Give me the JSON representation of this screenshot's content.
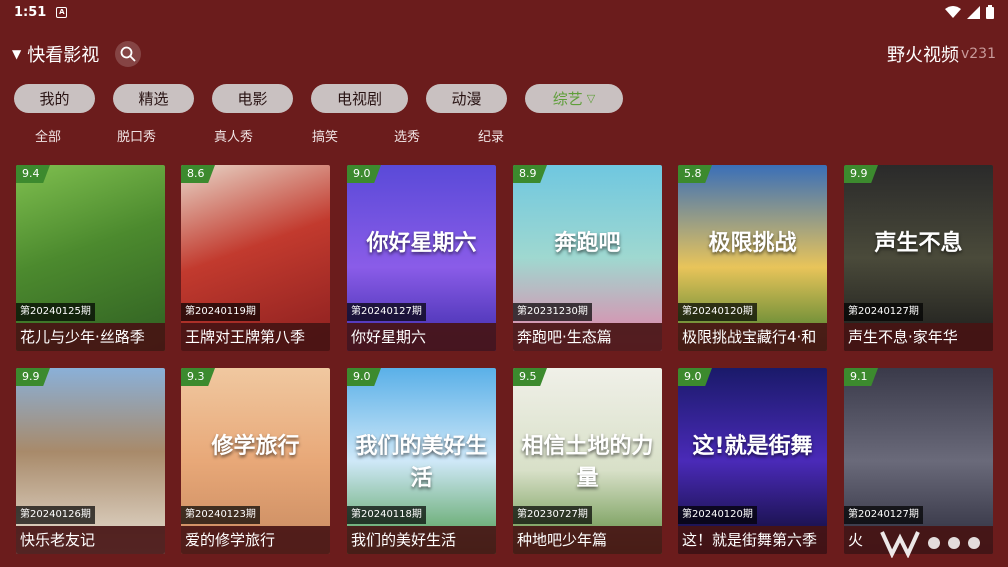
{
  "status": {
    "time": "1:51",
    "notif_glyph": "A"
  },
  "header": {
    "caret": "▼",
    "title": "快看影视",
    "brand": "野火视频",
    "version": "v231"
  },
  "tabs": [
    {
      "label": "我的"
    },
    {
      "label": "精选"
    },
    {
      "label": "电影"
    },
    {
      "label": "电视剧"
    },
    {
      "label": "动漫"
    },
    {
      "label": "综艺"
    }
  ],
  "subtabs": [
    "全部",
    "脱口秀",
    "真人秀",
    "搞笑",
    "选秀",
    "纪录"
  ],
  "cards": [
    {
      "rating": "9.4",
      "episode": "第20240125期",
      "title": "花儿与少年·丝路季",
      "poster": "green-field"
    },
    {
      "rating": "8.6",
      "episode": "第20240119期",
      "title": "王牌对王牌第八季",
      "poster": "red-party"
    },
    {
      "rating": "9.0",
      "episode": "第20240127期",
      "title": "你好星期六",
      "poster": "purple-show",
      "overlay": "你好星期六"
    },
    {
      "rating": "8.9",
      "episode": "第20231230期",
      "title": "奔跑吧·生态篇",
      "poster": "teal-run",
      "overlay": "奔跑吧"
    },
    {
      "rating": "5.8",
      "episode": "第20240120期",
      "title": "极限挑战宝藏行4·和",
      "poster": "sunset-hill",
      "overlay": "极限挑战"
    },
    {
      "rating": "9.9",
      "episode": "第20240127期",
      "title": "声生不息·家年华",
      "poster": "dark-vinyl",
      "overlay": "声生不息"
    },
    {
      "rating": "9.9",
      "episode": "第20240126期",
      "title": "快乐老友记",
      "poster": "house-friends"
    },
    {
      "rating": "9.3",
      "episode": "第20240123期",
      "title": "爱的修学旅行",
      "poster": "warm-travel",
      "overlay": "修学旅行"
    },
    {
      "rating": "9.0",
      "episode": "第20240118期",
      "title": "我们的美好生活",
      "poster": "blue-sky",
      "overlay": "我们的美好生活"
    },
    {
      "rating": "9.5",
      "episode": "第20230727期",
      "title": "种地吧少年篇",
      "poster": "white-farm",
      "overlay": "相信土地的力量"
    },
    {
      "rating": "9.0",
      "episode": "第20240120期",
      "title": "这！就是街舞第六季",
      "poster": "neon-dance",
      "overlay": "这!就是街舞"
    },
    {
      "rating": "9.1",
      "episode": "第20240127期",
      "title": "火",
      "poster": "dark-group"
    }
  ],
  "colors": {
    "background": "#6b1c1c",
    "tab_bg": "#c9c1c1",
    "active_tab": "#5f9e3a",
    "rating_bg": "#3c8a2e"
  }
}
